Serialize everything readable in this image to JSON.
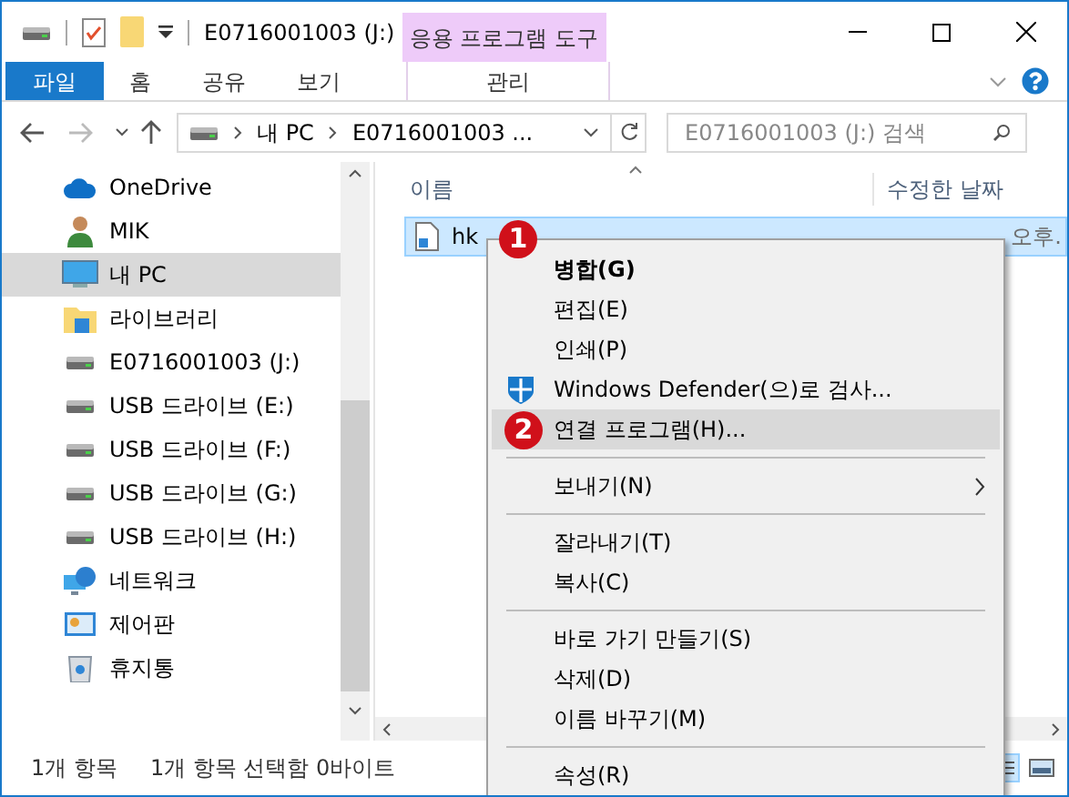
{
  "title_bar": {
    "title": "E0716001003 (J:)",
    "context_tab": "응용 프로그램 도구"
  },
  "ribbon": {
    "tabs": [
      {
        "label": "파일",
        "kind": "file"
      },
      {
        "label": "홈",
        "kind": "tab"
      },
      {
        "label": "공유",
        "kind": "tab"
      },
      {
        "label": "보기",
        "kind": "tab"
      },
      {
        "label": "관리",
        "kind": "context"
      }
    ]
  },
  "address_bar": {
    "path": [
      "내 PC",
      "E0716001003 ..."
    ],
    "search": {
      "placeholder": "E0716001003 (J:) 검색"
    }
  },
  "sidebar": {
    "items": [
      {
        "label": "OneDrive",
        "kind": "cloud",
        "selected": false
      },
      {
        "label": "MIK",
        "kind": "user",
        "selected": false
      },
      {
        "label": "내 PC",
        "kind": "pc",
        "selected": true
      },
      {
        "label": "라이브러리",
        "kind": "library",
        "selected": false
      },
      {
        "label": "E0716001003 (J:)",
        "kind": "drive",
        "selected": false
      },
      {
        "label": "USB 드라이브 (E:)",
        "kind": "drive",
        "selected": false
      },
      {
        "label": "USB 드라이브 (F:)",
        "kind": "drive",
        "selected": false
      },
      {
        "label": "USB 드라이브 (G:)",
        "kind": "drive",
        "selected": false
      },
      {
        "label": "USB 드라이브 (H:)",
        "kind": "drive",
        "selected": false
      },
      {
        "label": "네트워크",
        "kind": "network",
        "selected": false
      },
      {
        "label": "제어판",
        "kind": "control",
        "selected": false
      },
      {
        "label": "휴지통",
        "kind": "trash",
        "selected": false
      }
    ]
  },
  "file_list": {
    "columns": [
      "이름",
      "수정한 날짜"
    ],
    "rows": [
      {
        "name": "hk",
        "date": "오후.",
        "selected": true
      }
    ]
  },
  "context_menu": {
    "items": [
      {
        "kind": "item",
        "label": "병합(G)",
        "bold": true,
        "selected": false,
        "submenu": false
      },
      {
        "kind": "item",
        "label": "편집(E)",
        "bold": false,
        "selected": false,
        "submenu": false
      },
      {
        "kind": "item",
        "label": "인쇄(P)",
        "bold": false,
        "selected": false,
        "submenu": false
      },
      {
        "kind": "shield",
        "label": "Windows Defender(으)로 검사...",
        "bold": false,
        "selected": false,
        "submenu": false
      },
      {
        "kind": "item",
        "label": "연결 프로그램(H)...",
        "bold": false,
        "selected": true,
        "submenu": false
      },
      {
        "kind": "separator"
      },
      {
        "kind": "item",
        "label": "보내기(N)",
        "bold": false,
        "selected": false,
        "submenu": true
      },
      {
        "kind": "separator"
      },
      {
        "kind": "item",
        "label": "잘라내기(T)",
        "bold": false,
        "selected": false,
        "submenu": false
      },
      {
        "kind": "item",
        "label": "복사(C)",
        "bold": false,
        "selected": false,
        "submenu": false
      },
      {
        "kind": "separator"
      },
      {
        "kind": "item",
        "label": "바로 가기 만들기(S)",
        "bold": false,
        "selected": false,
        "submenu": false
      },
      {
        "kind": "item",
        "label": "삭제(D)",
        "bold": false,
        "selected": false,
        "submenu": false
      },
      {
        "kind": "item",
        "label": "이름 바꾸기(M)",
        "bold": false,
        "selected": false,
        "submenu": false
      },
      {
        "kind": "separator"
      },
      {
        "kind": "item",
        "label": "속성(R)",
        "bold": false,
        "selected": false,
        "submenu": false
      }
    ]
  },
  "callouts": [
    {
      "label": "1"
    },
    {
      "label": "2"
    }
  ],
  "status_bar": [
    "1개 항목",
    "1개 항목 선택함 0바이트"
  ]
}
